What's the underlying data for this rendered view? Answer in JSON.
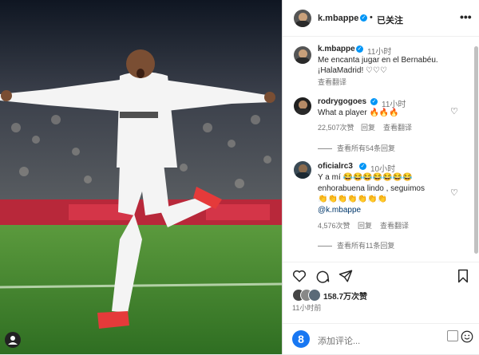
{
  "post": {
    "username": "k.mbappe",
    "follow_state": "已关注",
    "separator": "•",
    "more_icon": "more-horizontal-icon"
  },
  "caption": {
    "username": "k.mbappe",
    "time": "11小时",
    "line1": "Me encanta jugar en el Bernabéu.",
    "line2": "¡HalaMadrid! ♡♡♡",
    "translate": "查看翻译"
  },
  "comments": [
    {
      "username": "rodrygogoes",
      "time": "11小时",
      "text": "What a player 🔥🔥🔥",
      "likes": "22,507次赞",
      "reply": "回复",
      "translate": "查看翻译",
      "view_replies": "查看所有54条回复"
    },
    {
      "username": "oficialrc3",
      "time": "10小时",
      "line1": "Y a mí 😂😂😂😂😂😂😂",
      "line2": "enhorabuena lindo , seguimos",
      "line3": "👏👏👏👏👏👏👏",
      "mention": "@k.mbappe",
      "likes": "4,576次赞",
      "reply": "回复",
      "translate": "查看翻译",
      "view_replies": "查看所有11条回复"
    }
  ],
  "stats": {
    "likes": "158.7万次赞",
    "time": "11小时前"
  },
  "composer": {
    "placeholder": "添加评论..."
  },
  "colors": {
    "verified": "#0095f6",
    "pitch": "#3f8a2c",
    "kit": "#f4f4f4"
  }
}
